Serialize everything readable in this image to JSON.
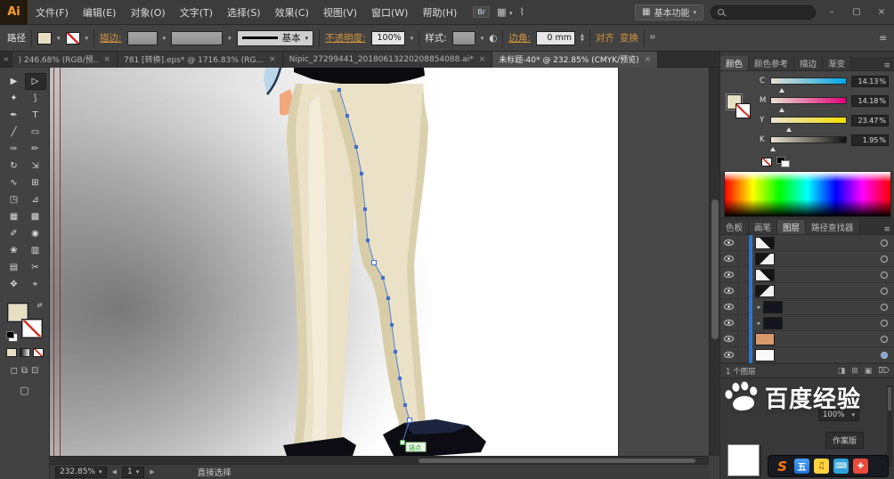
{
  "glyphs": {
    "caret": "▾",
    "close": "×",
    "chevron_left": "«",
    "chevron_overflow": "»",
    "panel_menu": "≡",
    "swap": "⇄",
    "expander": "▸",
    "arrow_left": "◀",
    "arrow_right": "▶",
    "recolor": "◐",
    "transform_icon": "⌗",
    "workspace_grid": "▦",
    "bridge": "Br",
    "extras": "⌇",
    "win_min": "–",
    "win_restore": "▢",
    "win_close": "×"
  },
  "menubar": {
    "logo": "Ai",
    "items": [
      "文件(F)",
      "编辑(E)",
      "对象(O)",
      "文字(T)",
      "选择(S)",
      "效果(C)",
      "视图(V)",
      "窗口(W)",
      "帮助(H)"
    ],
    "workspace": "基本功能"
  },
  "controlbar": {
    "context": "路径",
    "stroke_label": "描边:",
    "line_style": "基本",
    "opacity_label": "不透明度:",
    "opacity_value": "100%",
    "style_label": "样式:",
    "corner_label": "边角:",
    "corner_value": "0 mm",
    "align_label": "对齐",
    "transform_label": "变换"
  },
  "tabs": [
    {
      "label": ") 246.68% (RGB/预.."
    },
    {
      "label": "781 [转换].eps* @ 1716.83% (RG..."
    },
    {
      "label": "Nipic_27299441_20180613220208854088.ai*"
    },
    {
      "label": "未标题-40* @ 232.85% (CMYK/预览)"
    }
  ],
  "toolbar": {
    "tools": [
      "▶",
      "▷",
      "✦",
      "⟆",
      "✒",
      "T",
      "╱",
      "▭",
      "✑",
      "✏",
      "↻",
      "⇲",
      "∿",
      "⊞",
      "◳",
      "⊿",
      "▦",
      "▩",
      "✐",
      "◉",
      "❀",
      "▥",
      "▤",
      "✂",
      "✥",
      "⌖"
    ],
    "modes": [
      "◻",
      "⧉",
      "⊡"
    ],
    "screen": "▢"
  },
  "canvas": {
    "anchor_tip": "锚点"
  },
  "statusbar": {
    "zoom": "232.85%",
    "artboard": "1",
    "tool_name": "直接选择"
  },
  "color_panel": {
    "tabs": [
      "颜色",
      "颜色参考",
      "描边",
      "渐变"
    ],
    "sliders": [
      {
        "ch": "C",
        "value": "14.13",
        "unit": "%"
      },
      {
        "ch": "M",
        "value": "14.18",
        "unit": "%"
      },
      {
        "ch": "Y",
        "value": "23.47",
        "unit": "%"
      },
      {
        "ch": "K",
        "value": "1.95",
        "unit": "%"
      }
    ]
  },
  "panels": {
    "tabs2": [
      "色板",
      "画笔",
      "图层",
      "路径查找器"
    ],
    "layers_footer": "1 个图层",
    "footer_icons": [
      "◨",
      "⊞",
      "▣",
      "⌦"
    ]
  },
  "bottom_panel": {
    "value": "100%",
    "button": "作案版"
  },
  "watermark": {
    "text": "百度经验"
  },
  "ime": {
    "icons": [
      {
        "label": "S"
      },
      {
        "label": "五"
      },
      {
        "label": "♫"
      },
      {
        "label": "⌨"
      },
      {
        "label": "✚"
      }
    ]
  }
}
